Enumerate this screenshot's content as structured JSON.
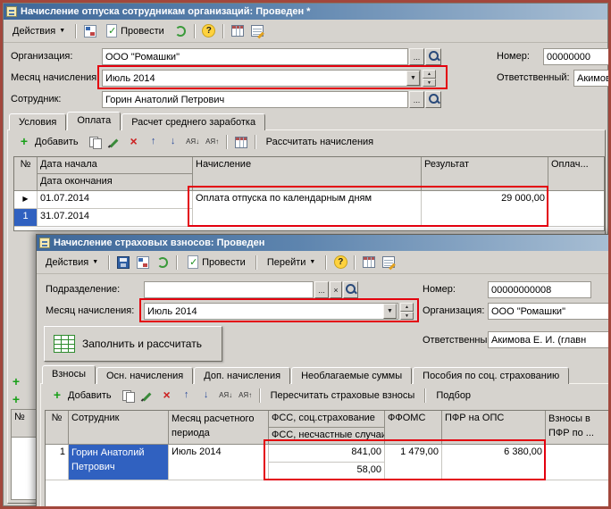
{
  "icons": {
    "dropdown": "▼",
    "spin_up": "▲",
    "spin_down": "▼",
    "ellipsis": "...",
    "clear": "×",
    "plus": "+",
    "delete": "×",
    "up": "↑",
    "down": "↓",
    "sort_asc": "АЯ↓",
    "sort_desc": "АЯ↑",
    "marker": "▶",
    "help": "?",
    "check": "✓"
  },
  "w1": {
    "title": "Начисление отпуска сотрудникам организаций: Проведен *",
    "toolbar": {
      "actions": "Действия",
      "post": "Провести"
    },
    "fields": {
      "org_label": "Организация:",
      "org_value": "ООО \"Ромашки\"",
      "number_label": "Номер:",
      "number_value": "00000000",
      "month_label": "Месяц начисления:",
      "month_value": "Июль 2014",
      "resp_label": "Ответственный:",
      "resp_value": "Акимов",
      "emp_label": "Сотрудник:",
      "emp_value": "Горин Анатолий Петрович"
    },
    "tabs": [
      "Условия",
      "Оплата",
      "Расчет среднего заработка"
    ],
    "panel_toolbar": {
      "add": "Добавить",
      "calc": "Рассчитать начисления"
    },
    "table": {
      "headers": {
        "num": "№",
        "date_start": "Дата начала",
        "date_end": "Дата окончания",
        "accrual": "Начисление",
        "result": "Результат",
        "paid": "Оплач..."
      },
      "row": {
        "num": "1",
        "date_start": "01.07.2014",
        "date_end": "31.07.2014",
        "accrual": "Оплата отпуска по календарным дням",
        "result": "29 000,00"
      }
    },
    "leftover": {
      "num_header": "№"
    }
  },
  "w2": {
    "title": "Начисление страховых взносов: Проведен",
    "toolbar": {
      "actions": "Действия",
      "post": "Провести",
      "goto": "Перейти"
    },
    "fields": {
      "dept_label": "Подразделение:",
      "dept_value": "",
      "number_label": "Номер:",
      "number_value": "00000000008",
      "month_label": "Месяц начисления:",
      "month_value": "Июль 2014",
      "org_label": "Организация:",
      "org_value": "ООО \"Ромашки\"",
      "resp_label": "Ответственный:",
      "resp_value": "Акимова Е. И. (главн",
      "fill_button": "Заполнить и рассчитать"
    },
    "tabs": [
      "Взносы",
      "Осн. начисления",
      "Доп. начисления",
      "Необлагаемые суммы",
      "Пособия по соц. страхованию"
    ],
    "panel_toolbar": {
      "add": "Добавить",
      "recalc": "Пересчитать страховые взносы",
      "pick": "Подбор"
    },
    "table": {
      "headers": {
        "num": "№",
        "employee": "Сотрудник",
        "month": "Месяц расчетного периода",
        "fss_social": "ФСС, соц.страхование",
        "fss_accident": "ФСС, несчастные случаи",
        "ffoms": "ФФОМС",
        "pfr": "ПФР на ОПС",
        "pfr_extra": "Взносы в ПФР по ..."
      },
      "row": {
        "num": "1",
        "employee": "Горин Анатолий Петрович",
        "month": "Июль 2014",
        "fss_social": "841,00",
        "fss_accident": "58,00",
        "ffoms": "1 479,00",
        "pfr": "6 380,00"
      }
    }
  }
}
